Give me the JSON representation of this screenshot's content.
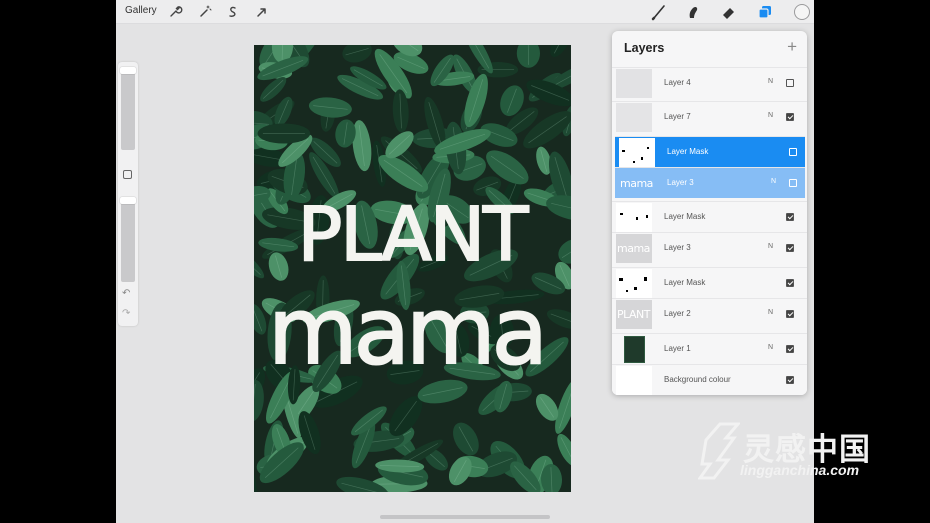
{
  "toolbar": {
    "gallery_label": "Gallery",
    "icons": [
      "wrench-icon",
      "magic-wand-icon",
      "selection-icon",
      "transform-icon",
      "brush-icon",
      "smudge-icon",
      "eraser-icon",
      "layers-icon",
      "color-icon"
    ],
    "accent": "#1a8cf2"
  },
  "canvas": {
    "lettering_line1": "PLANT",
    "lettering_line2": "mama"
  },
  "layers_panel": {
    "title": "Layers",
    "add_label": "+",
    "rows": [
      {
        "name": "Layer 4",
        "blend": "N",
        "checked": false
      },
      {
        "name": "Layer 7",
        "blend": "N",
        "checked": true
      },
      {
        "name": "Layer Mask",
        "blend": "",
        "checked": false
      },
      {
        "name": "Layer 3",
        "blend": "N",
        "checked": false
      },
      {
        "name": "Layer Mask",
        "blend": "",
        "checked": true
      },
      {
        "name": "Layer 3",
        "blend": "N",
        "checked": true
      },
      {
        "name": "Layer Mask",
        "blend": "",
        "checked": true
      },
      {
        "name": "Layer 2",
        "blend": "N",
        "checked": true
      },
      {
        "name": "Layer 1",
        "blend": "N",
        "checked": true
      },
      {
        "name": "Background colour",
        "blend": "",
        "checked": true
      }
    ],
    "thumb_texts": {
      "layer3": "mama",
      "layer2": "PLANT"
    }
  },
  "watermark": {
    "cn": "灵感中国",
    "en": "lingganchina.com"
  }
}
